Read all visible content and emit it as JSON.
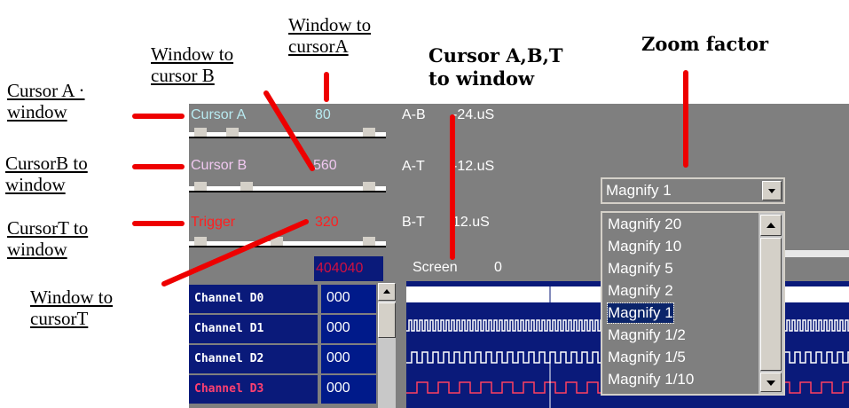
{
  "annotations": {
    "window_to_cursorA": [
      "Window to",
      "cursorA"
    ],
    "window_to_cursorB": [
      "Window to",
      "cursor B"
    ],
    "cursorA_to_window": [
      "Cursor A ·",
      "window"
    ],
    "cursorB_to_window": [
      "CursorB to",
      "window"
    ],
    "cursorT_to_window": [
      "CursorT to",
      "window"
    ],
    "window_to_cursorT": [
      "Window to",
      "cursorT"
    ],
    "cursor_abt_to_window": [
      "Cursor A,B,T",
      "to window"
    ],
    "zoom_factor": "Zoom factor"
  },
  "cursors": [
    {
      "label": "Cursor A",
      "value": "80",
      "label_color": "#b8eaf0",
      "value_color": "#b8eaf0"
    },
    {
      "label": "Cursor B",
      "value": "560",
      "label_color": "#f0c8f0",
      "value_color": "#f0c8f0"
    },
    {
      "label": "Trigger",
      "value": "320",
      "label_color": "#ff2020",
      "value_color": "#ff2020"
    }
  ],
  "deltas": [
    {
      "label": "A-B",
      "value": "-24.uS"
    },
    {
      "label": "A-T",
      "value": "-12.uS"
    },
    {
      "label": "B-T",
      "value": "12.uS"
    }
  ],
  "screen": {
    "label": "Screen",
    "value": "0"
  },
  "bit_header": "404040",
  "channels": [
    {
      "name": "Channel D0",
      "bits": "000"
    },
    {
      "name": "Channel D1",
      "bits": "000"
    },
    {
      "name": "Channel D2",
      "bits": "000"
    },
    {
      "name": "Channel D3",
      "bits": "000"
    }
  ],
  "magnify": {
    "selected": "Magnify 1",
    "options": [
      "Magnify 20",
      "Magnify 10",
      "Magnify 5",
      "Magnify 2",
      "Magnify 1",
      "Magnify 1/2",
      "Magnify 1/5",
      "Magnify 1/10"
    ]
  },
  "colors": {
    "panel": "#7f7f7f",
    "channel_bg": "#0a1a7a",
    "annotation_line": "#ee0000"
  }
}
